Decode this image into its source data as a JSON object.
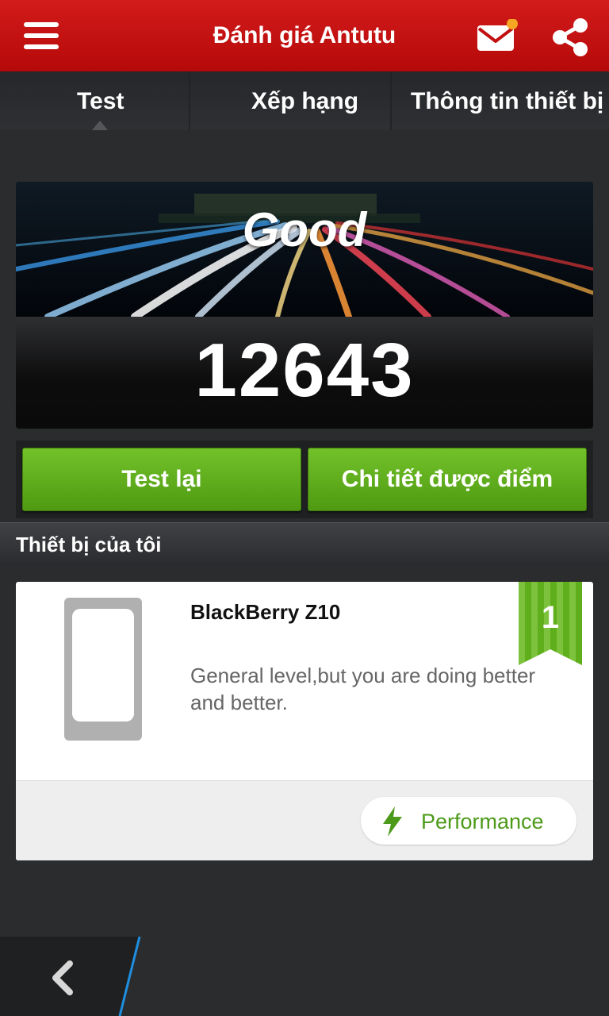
{
  "header": {
    "title": "Đánh giá Antutu",
    "icons": [
      "menu-icon",
      "mail-icon",
      "share-icon"
    ],
    "brand_color": "#c80f0f",
    "notification_dot_color": "#f6a623"
  },
  "tabs": [
    {
      "label": "Test",
      "active": true
    },
    {
      "label": "Xếp hạng",
      "active": false
    },
    {
      "label": "Thông tin thiết bị",
      "active": false
    }
  ],
  "score": {
    "grade": "Good",
    "value": "12643"
  },
  "actions": {
    "retest_label": "Test lại",
    "details_label": "Chi tiết được điểm",
    "button_color": "#5fae1c"
  },
  "my_device": {
    "section_title": "Thiết bị của tôi",
    "name": "BlackBerry Z10",
    "description": "General level,but you are doing better and better.",
    "rank": "1",
    "performance_label": "Performance",
    "performance_icon": "lightning-bolt-icon",
    "accent_color": "#4d9a1a"
  },
  "navigation": {
    "back_icon": "chevron-left-icon",
    "accent_line_color": "#1e8fe0"
  }
}
